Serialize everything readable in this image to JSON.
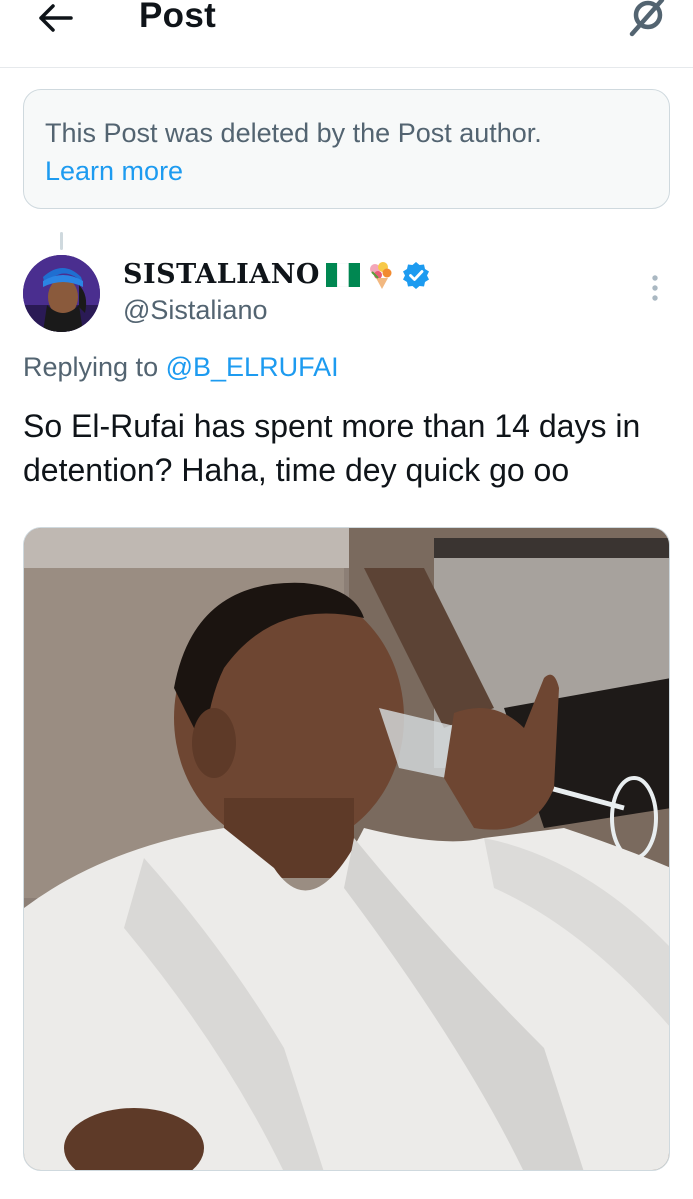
{
  "header": {
    "title": "Post",
    "back_icon": "arrow-left-icon",
    "grok_icon": "grok-icon"
  },
  "deleted_notice": {
    "message": "This Post was deleted by the Post author.",
    "link": "Learn more"
  },
  "post": {
    "author": {
      "display_name": "SISTALIANO",
      "flag_emoji": "🇳🇬",
      "bouquet_emoji": "💐",
      "handle": "@Sistaliano",
      "verified": true,
      "verified_color": "#1d9bf0"
    },
    "replying_prefix": "Replying to",
    "replying_to": "@B_ELRUFAI",
    "text": "So El-Rufai has spent more than 14 days in detention? Haha, time dey quick go oo",
    "media": {
      "description_icon": "photo-icon"
    }
  },
  "colors": {
    "text_primary": "#0f1419",
    "text_secondary": "#536471",
    "accent": "#1d9bf0",
    "border": "#cfd9de"
  }
}
